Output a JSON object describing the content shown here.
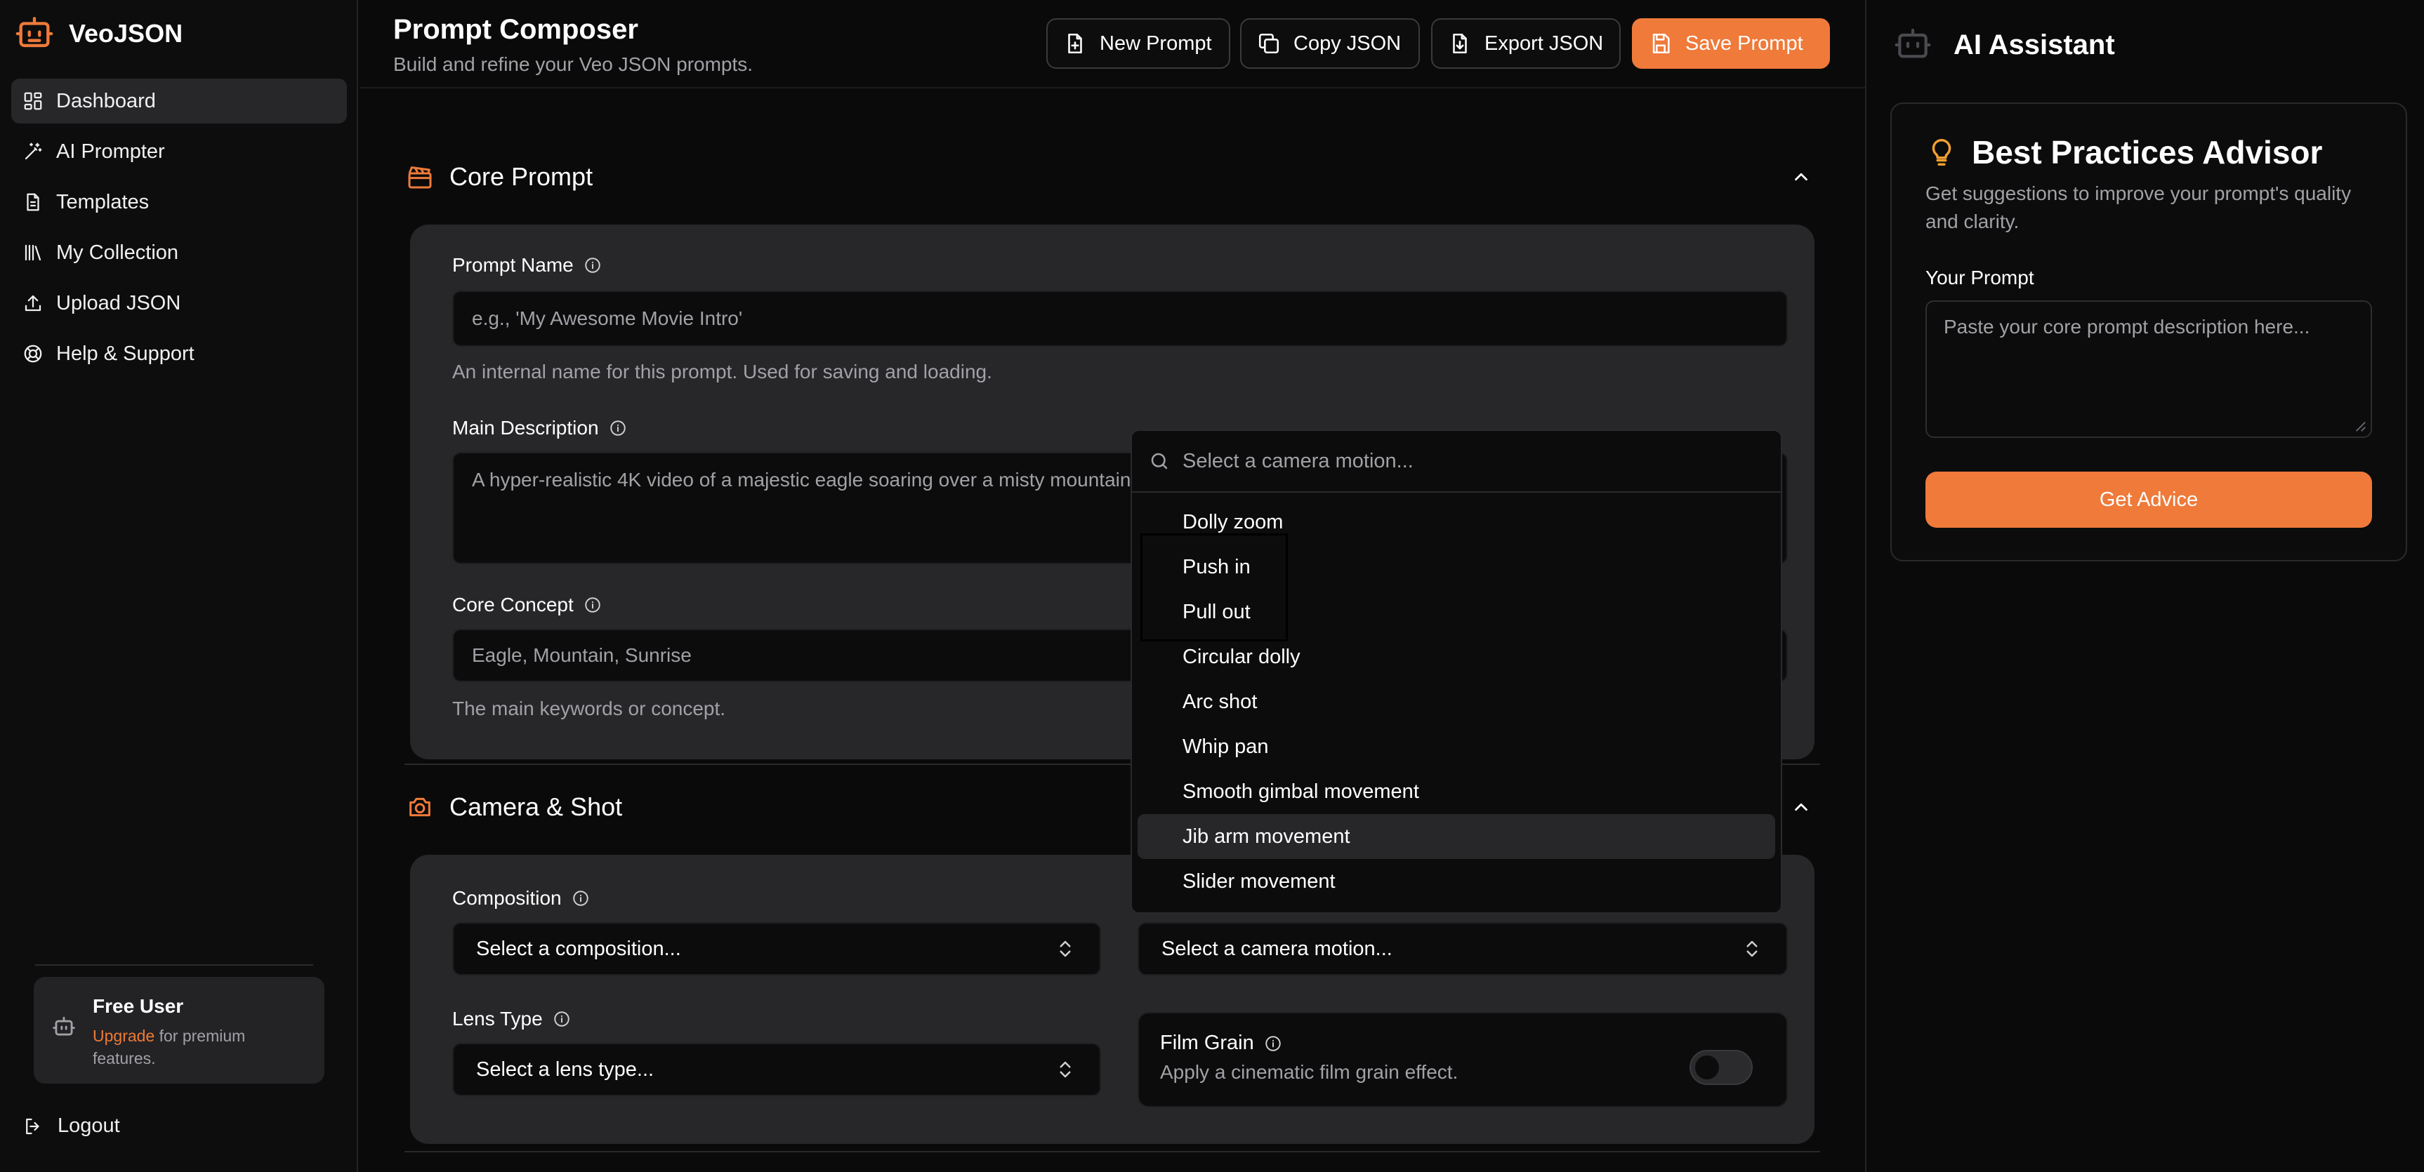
{
  "brand": {
    "name": "VeoJSON",
    "accent": "#ef7a3a"
  },
  "sidebar": {
    "items": [
      {
        "label": "Dashboard",
        "icon": "dashboard-icon",
        "active": true
      },
      {
        "label": "AI Prompter",
        "icon": "magic-wand-icon"
      },
      {
        "label": "Templates",
        "icon": "document-icon"
      },
      {
        "label": "My Collection",
        "icon": "library-icon"
      },
      {
        "label": "Upload JSON",
        "icon": "upload-icon"
      },
      {
        "label": "Help & Support",
        "icon": "lifebuoy-icon"
      }
    ],
    "user": {
      "title": "Free User",
      "upgrade": "Upgrade",
      "rest": " for premium features."
    },
    "logout": "Logout"
  },
  "header": {
    "title": "Prompt Composer",
    "subtitle": "Build and refine your Veo JSON prompts.",
    "buttons": {
      "new": "New Prompt",
      "copy": "Copy JSON",
      "export": "Export JSON",
      "save": "Save Prompt"
    }
  },
  "core": {
    "title": "Core Prompt",
    "name_label": "Prompt Name",
    "name_placeholder": "e.g., 'My Awesome Movie Intro'",
    "name_help": "An internal name for this prompt. Used for saving and loading.",
    "desc_label": "Main Description",
    "desc_placeholder": "A hyper-realistic 4K video of a majestic eagle soaring over a misty mountain",
    "concept_label": "Core Concept",
    "concept_placeholder": "Eagle, Mountain, Sunrise",
    "concept_help": "The main keywords or concept."
  },
  "camera": {
    "title": "Camera & Shot",
    "composition_label": "Composition",
    "composition_value": "Select a composition...",
    "motion_value": "Select a camera motion...",
    "lens_label": "Lens Type",
    "lens_value": "Select a lens type...",
    "grain_title": "Film Grain",
    "grain_sub": "Apply a cinematic film grain effect.",
    "grain_on": false
  },
  "dropdown": {
    "search_placeholder": "Select a camera motion...",
    "options": [
      "Dolly zoom",
      "Push in",
      "Pull out",
      "Circular dolly",
      "Arc shot",
      "Whip pan",
      "Smooth gimbal movement",
      "Jib arm movement",
      "Slider movement"
    ],
    "highlighted": "Jib arm movement"
  },
  "assistant": {
    "title": "AI Assistant",
    "advisor_title": "Best Practices Advisor",
    "advisor_sub": "Get suggestions to improve your prompt's quality and clarity.",
    "prompt_label": "Your Prompt",
    "prompt_placeholder": "Paste your core prompt description here...",
    "button": "Get Advice"
  }
}
